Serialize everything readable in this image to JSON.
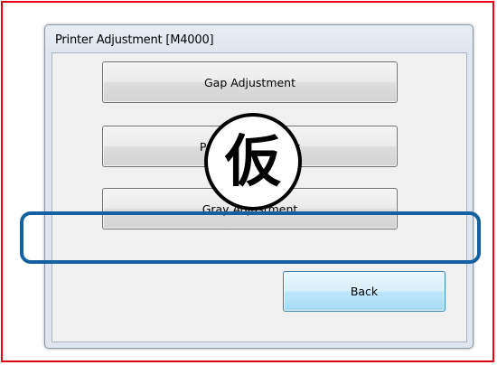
{
  "window": {
    "title": "Printer Adjustment [M4000]"
  },
  "buttons": {
    "gap_label": "Gap Adjustment",
    "paper_label": "Paper Adjustment",
    "gray_label": "Gray Adjustment",
    "back_label": "Back"
  },
  "stamp": {
    "text": "仮"
  },
  "colors": {
    "outer_frame": "#e60012",
    "highlight": "#1460a0"
  }
}
